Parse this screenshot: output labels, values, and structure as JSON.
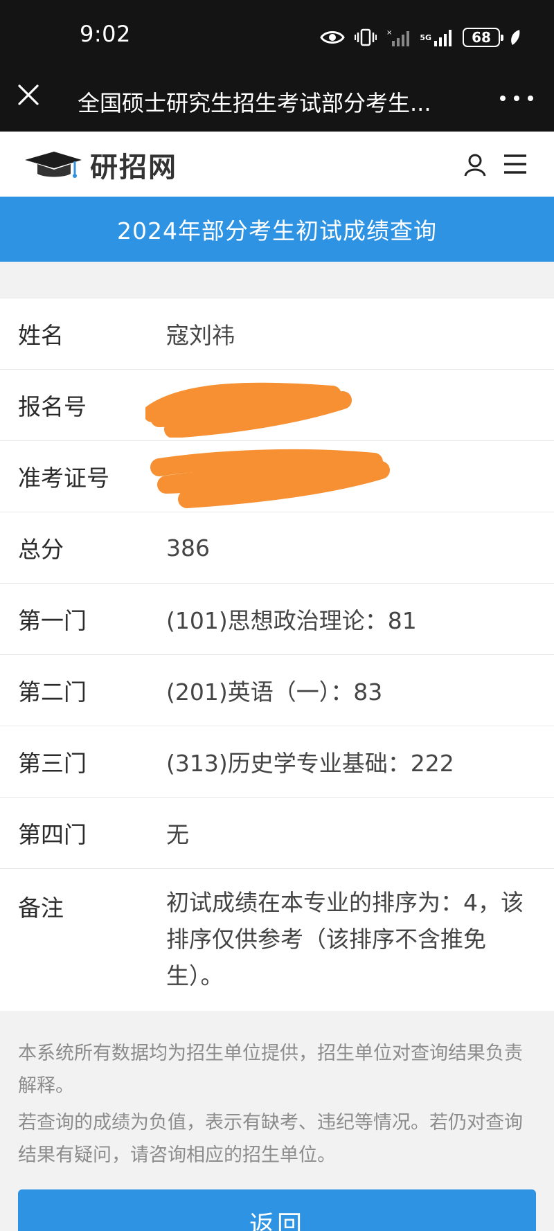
{
  "status_bar": {
    "time": "9:02",
    "network": "5G",
    "battery": "68"
  },
  "title_bar": {
    "title": "全国硕士研究生招生考试部分考生..."
  },
  "header": {
    "logo_text": "研招网"
  },
  "banner": {
    "title": "2024年部分考生初试成绩查询"
  },
  "rows": [
    {
      "label": "姓名",
      "value": "寇刘祎"
    },
    {
      "label": "报名号",
      "value": ""
    },
    {
      "label": "准考证号",
      "value": ""
    },
    {
      "label": "总分",
      "value": "386"
    },
    {
      "label": "第一门",
      "value": "(101)思想政治理论：81"
    },
    {
      "label": "第二门",
      "value": "(201)英语（一）：83"
    },
    {
      "label": "第三门",
      "value": "(313)历史学专业基础：222"
    },
    {
      "label": "第四门",
      "value": "无"
    },
    {
      "label": "备注",
      "value": "初试成绩在本专业的排序为：4，该排序仅供参考（该排序不含推免生）。"
    }
  ],
  "notes": {
    "line1": "本系统所有数据均为招生单位提供，招生单位对查询结果负责解释。",
    "line2": "若查询的成绩为负值，表示有缺考、违纪等情况。若仍对查询结果有疑问，请咨询相应的招生单位。"
  },
  "back_button": {
    "label": "返回"
  },
  "colors": {
    "accent": "#2f93e3",
    "redaction": "#f79033",
    "top_bar": "#141414"
  },
  "icons": [
    "eye-icon",
    "vibrate-icon",
    "signal-icon",
    "battery-icon",
    "leaf-icon",
    "close-icon",
    "more-icon",
    "graduation-cap-icon",
    "user-icon",
    "menu-icon"
  ]
}
